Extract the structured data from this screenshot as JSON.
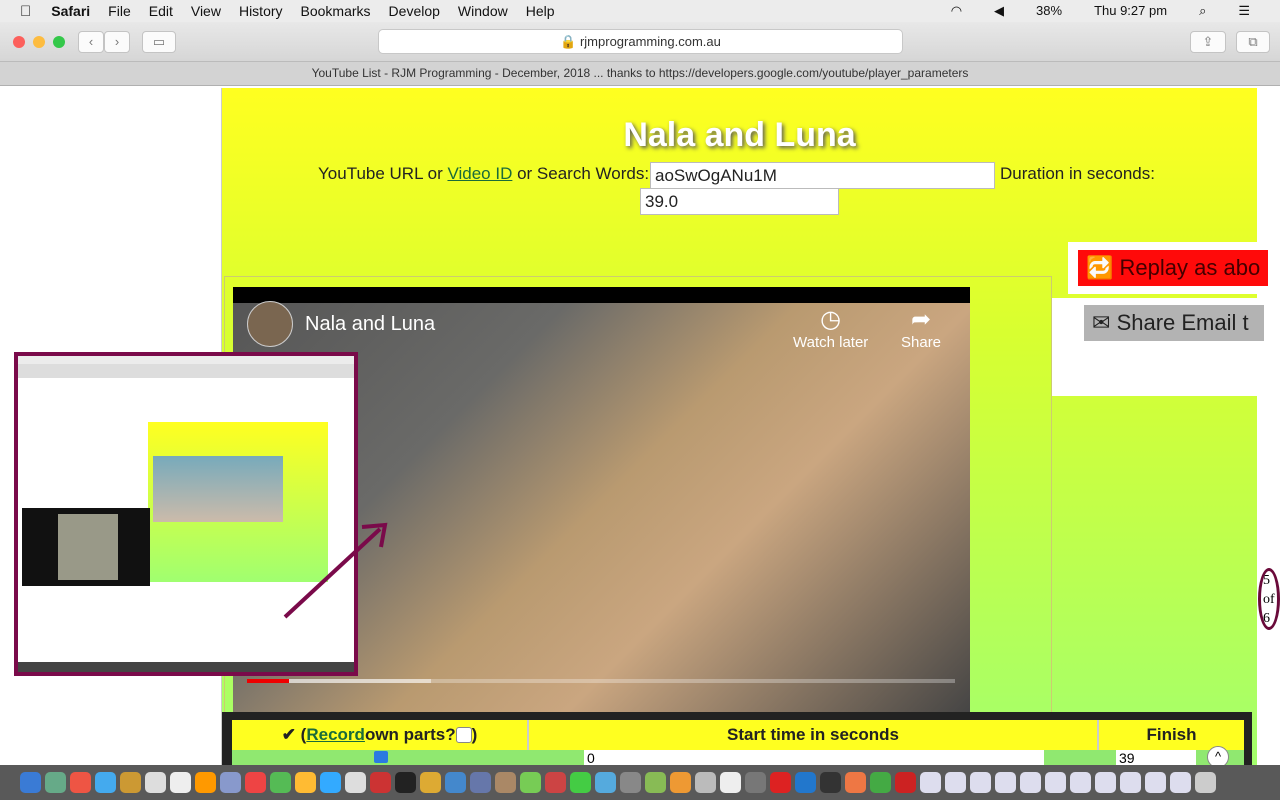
{
  "menubar": {
    "apple": "",
    "app": "Safari",
    "items": [
      "File",
      "Edit",
      "View",
      "History",
      "Bookmarks",
      "Develop",
      "Window",
      "Help"
    ],
    "battery": "38%",
    "clock": "Thu 9:27 pm"
  },
  "toolbar": {
    "url": "rjmprogramming.com.au"
  },
  "tab": {
    "title": "YouTube List - RJM Programming - December, 2018 ... thanks to https://developers.google.com/youtube/player_parameters"
  },
  "page": {
    "title": "Nala and Luna",
    "label_prefix": "YouTube URL or ",
    "video_id_link": "Video ID",
    "label_mid": " or Search Words:",
    "video_value": "aoSwOgANu1M",
    "duration_label": "Duration in seconds:",
    "duration_value": "39.0",
    "replay_label": "Replay as abo",
    "share_label": "Share Email t",
    "pager": [
      "5",
      "of",
      "6"
    ]
  },
  "video": {
    "title": "Nala and Luna",
    "watch_later": "Watch later",
    "share": "Share",
    "played_fraction": 0.06,
    "buffered_fraction": 0.26
  },
  "table": {
    "col1_check": "✔ (",
    "col1_link": "Record",
    "col1_rest": " own parts? ",
    "col1_end": " )",
    "col2": "Start time in seconds",
    "col3": "Finish",
    "start_value": "0",
    "finish_value": "39"
  },
  "colors": {
    "accent_yellow": "#ffff20",
    "inset_border": "#7a0a4a",
    "replay": "#ff0a0a"
  }
}
